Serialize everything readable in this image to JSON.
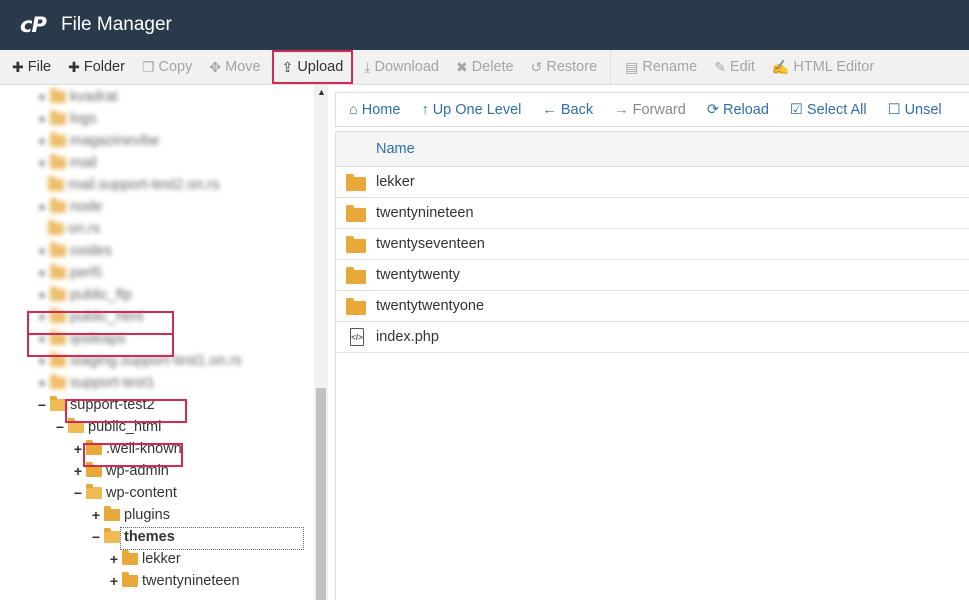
{
  "header": {
    "logo": "cP",
    "title": "File Manager"
  },
  "toolbar": [
    {
      "label": "File",
      "icon": "plus-icon",
      "glyph": "✚",
      "enabled": true
    },
    {
      "label": "Folder",
      "icon": "plus-icon",
      "glyph": "✚",
      "enabled": true
    },
    {
      "label": "Copy",
      "icon": "copy-icon",
      "glyph": "❐",
      "enabled": false
    },
    {
      "label": "Move",
      "icon": "move-icon",
      "glyph": "✥",
      "enabled": false
    },
    {
      "label": "Upload",
      "icon": "upload-icon",
      "glyph": "⇪",
      "enabled": true,
      "highlighted": true
    },
    {
      "label": "Download",
      "icon": "download-icon",
      "glyph": "⤓",
      "enabled": false
    },
    {
      "label": "Delete",
      "icon": "close-icon",
      "glyph": "✖",
      "enabled": false
    },
    {
      "label": "Restore",
      "icon": "restore-icon",
      "glyph": "↺",
      "enabled": false
    },
    {
      "label": "Rename",
      "icon": "file-icon",
      "glyph": "▤",
      "enabled": false,
      "separator_before": true
    },
    {
      "label": "Edit",
      "icon": "pencil-icon",
      "glyph": "✎",
      "enabled": false
    },
    {
      "label": "HTML Editor",
      "icon": "edit-icon",
      "glyph": "✍",
      "enabled": false
    }
  ],
  "tree": {
    "blurred_items": [
      "kvadrat",
      "logs",
      "magazinevibe",
      "mail",
      "mail.support-test2.on.rs",
      "node",
      "on.rs",
      "oxides",
      "perl5",
      "public_ftp",
      "public_html",
      "qodeaps",
      "staging.support-test1.on.rs",
      "support-test1"
    ],
    "items": [
      {
        "label": "support-test2",
        "toggle": "−",
        "open": true
      },
      {
        "label": "public_html",
        "toggle": "−",
        "open": true
      },
      {
        "label": ".well-known",
        "toggle": "+",
        "open": false
      },
      {
        "label": "wp-admin",
        "toggle": "+",
        "open": false
      },
      {
        "label": "wp-content",
        "toggle": "−",
        "open": true
      },
      {
        "label": "plugins",
        "toggle": "+",
        "open": false
      },
      {
        "label": "themes",
        "toggle": "−",
        "open": true,
        "selected": true
      },
      {
        "label": "lekker",
        "toggle": "+",
        "open": false
      },
      {
        "label": "twentynineteen",
        "toggle": "+",
        "open": false
      }
    ]
  },
  "nav": [
    {
      "label": "Home",
      "icon": "home-icon",
      "glyph": "⌂",
      "enabled": true
    },
    {
      "label": "Up One Level",
      "icon": "arrow-up-icon",
      "glyph": "↑",
      "enabled": true
    },
    {
      "label": "Back",
      "icon": "arrow-left-icon",
      "glyph": "←",
      "enabled": true
    },
    {
      "label": "Forward",
      "icon": "arrow-right-icon",
      "glyph": "→",
      "enabled": false
    },
    {
      "label": "Reload",
      "icon": "reload-icon",
      "glyph": "⟳",
      "enabled": true
    },
    {
      "label": "Select All",
      "icon": "checkbox-checked-icon",
      "glyph": "☑",
      "enabled": true
    },
    {
      "label": "Unsel",
      "icon": "checkbox-empty-icon",
      "glyph": "☐",
      "enabled": true
    }
  ],
  "files": {
    "column_name": "Name",
    "rows": [
      {
        "name": "lekker",
        "type": "folder"
      },
      {
        "name": "twentynineteen",
        "type": "folder"
      },
      {
        "name": "twentyseventeen",
        "type": "folder"
      },
      {
        "name": "twentytwenty",
        "type": "folder"
      },
      {
        "name": "twentytwentyone",
        "type": "folder"
      },
      {
        "name": "index.php",
        "type": "php",
        "badge": "</>"
      }
    ]
  },
  "colors": {
    "header_bg": "#293a4a",
    "highlight": "#d6294f",
    "link": "#2f6fae",
    "folder": "#e8a93a"
  }
}
